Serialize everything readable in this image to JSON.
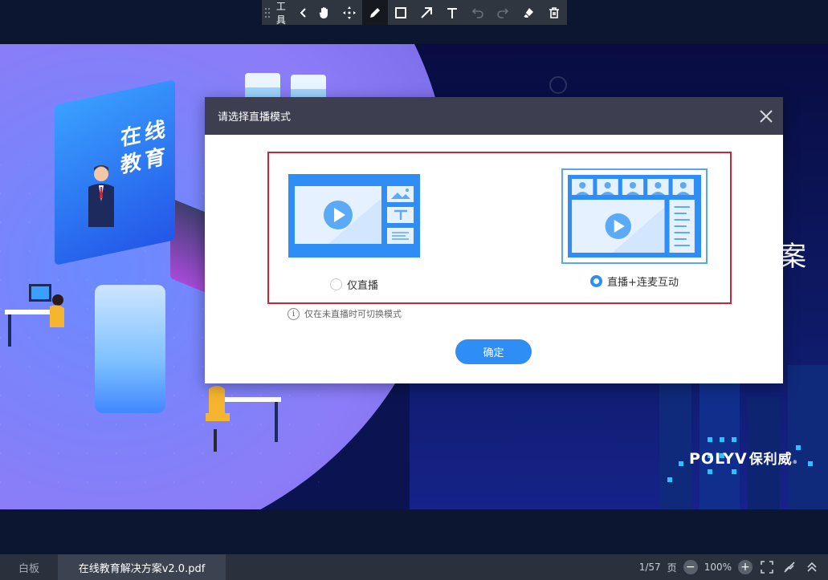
{
  "toolbar": {
    "tools_label": "工具",
    "tools": [
      "hand-icon",
      "move-icon",
      "pen-icon",
      "rectangle-icon",
      "arrow-icon",
      "text-icon",
      "undo-icon",
      "redo-icon",
      "eraser-icon",
      "trash-icon"
    ],
    "active_tool": "pen-icon"
  },
  "slide": {
    "board_text_line1": "在线",
    "board_text_line2": "教育",
    "title_fragment": "案",
    "logo_text": "POLYV",
    "logo_cn": "保利威",
    "logo_mark": "®"
  },
  "dialog": {
    "title": "请选择直播模式",
    "mode_live_only": "仅直播",
    "mode_live_interactive": "直播+连麦互动",
    "selected_mode": "mode_live_interactive",
    "note": "仅在未直播时可切换模式",
    "note_icon_glyph": "i",
    "confirm_label": "确定"
  },
  "bottombar": {
    "tab_whiteboard": "白板",
    "tab_document": "在线教育解决方案v2.0.pdf",
    "page_indicator": "1/57",
    "page_unit": "页",
    "zoom": "100%",
    "zoom_out": "−",
    "zoom_in": "+"
  },
  "colors": {
    "accent": "#2f8ef5",
    "highlight_border": "#c9253a",
    "dialog_header": "#3d3f50",
    "toolbar_bg": "#30363f",
    "bottombar_bg": "#2b313c"
  }
}
